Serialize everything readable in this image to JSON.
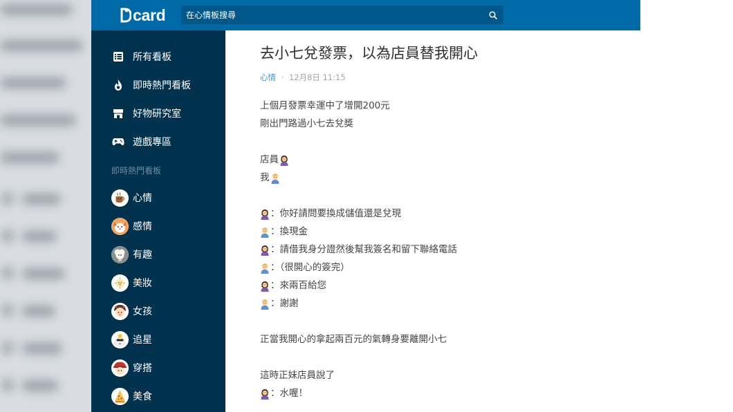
{
  "header": {
    "logo_text": "card",
    "search_placeholder": "在心情板搜尋"
  },
  "sidebar": {
    "nav": [
      {
        "label": "所有看板",
        "icon": "list-icon"
      },
      {
        "label": "即時熱門看板",
        "icon": "flame-icon"
      },
      {
        "label": "好物研究室",
        "icon": "store-icon"
      },
      {
        "label": "遊戲專區",
        "icon": "gamepad-icon"
      }
    ],
    "section_title": "即時熱門看板",
    "boards": [
      {
        "label": "心情",
        "icon": "coffee-avatar-icon"
      },
      {
        "label": "感情",
        "icon": "dog-avatar-icon"
      },
      {
        "label": "有趣",
        "icon": "sheep-avatar-icon"
      },
      {
        "label": "美妝",
        "icon": "sparkle-avatar-icon"
      },
      {
        "label": "女孩",
        "icon": "girl-avatar-icon"
      },
      {
        "label": "追星",
        "icon": "star-avatar-icon"
      },
      {
        "label": "穿搭",
        "icon": "fashion-avatar-icon"
      },
      {
        "label": "美食",
        "icon": "food-avatar-icon"
      }
    ]
  },
  "post": {
    "title": "去小七兌發票，以為店員替我開心",
    "board": "心情",
    "separator": "·",
    "date": "12月8日 11:15",
    "lines": [
      {
        "text": "上個月發票幸運中了增開200元"
      },
      {
        "text": "剛出門路過小七去兌獎"
      },
      {
        "text": ""
      },
      {
        "text": "店員",
        "emoji_after": "woman"
      },
      {
        "text": "我",
        "emoji_after": "man"
      },
      {
        "text": ""
      },
      {
        "emoji": "woman",
        "text": "：你好請問要換成儲值還是兌現"
      },
      {
        "emoji": "man",
        "text": "：換現金"
      },
      {
        "emoji": "woman",
        "text": "：請借我身分證然後幫我簽名和留下聯絡電話"
      },
      {
        "emoji": "man",
        "text": "：（很開心的簽完）"
      },
      {
        "emoji": "woman",
        "text": "：來兩百給您"
      },
      {
        "emoji": "man",
        "text": "：謝謝"
      },
      {
        "text": ""
      },
      {
        "text": "正當我開心的拿起兩百元的氣轉身要離開小七"
      },
      {
        "text": ""
      },
      {
        "text": "這時正妹店員說了"
      },
      {
        "emoji": "woman",
        "text": "：水喔！"
      }
    ]
  },
  "colors": {
    "header": "#006aa6",
    "sidebar": "#00324e",
    "accent": "#3397cf"
  }
}
